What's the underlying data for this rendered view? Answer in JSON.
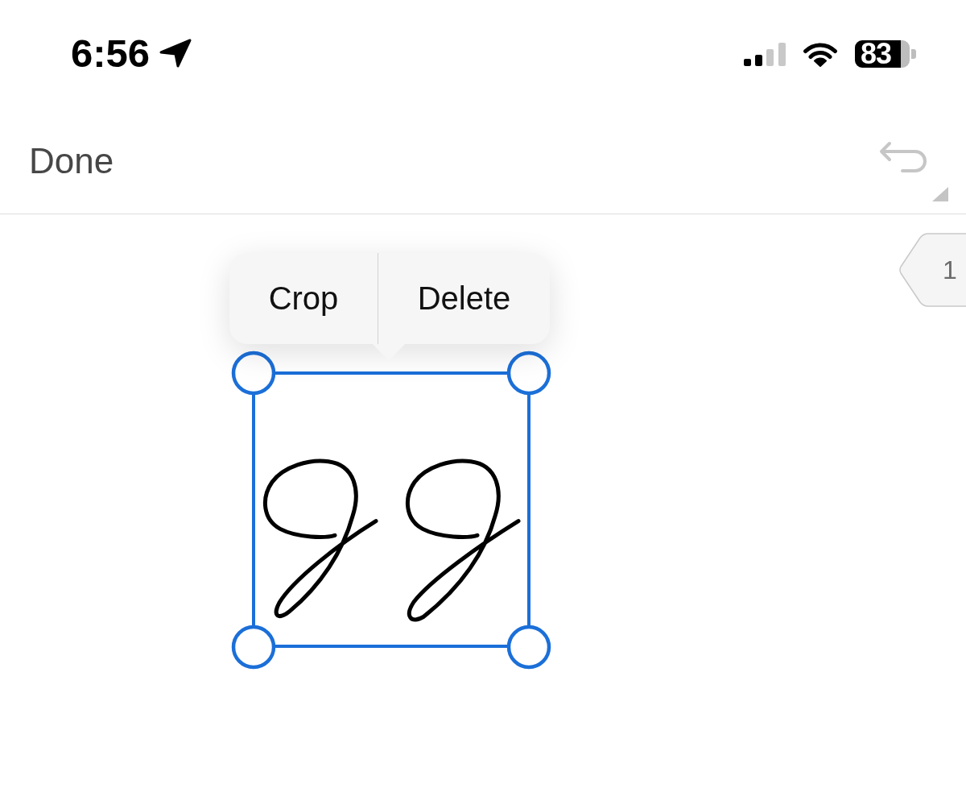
{
  "status_bar": {
    "time": "6:56",
    "battery": "83"
  },
  "toolbar": {
    "done_button": "Done",
    "undo": {
      "disabled": true
    }
  },
  "page_tab": {
    "label": "1"
  },
  "context_menu": {
    "items": [
      {
        "label": "Crop"
      },
      {
        "label": "Delete"
      }
    ]
  },
  "signature": {
    "selected": true
  }
}
